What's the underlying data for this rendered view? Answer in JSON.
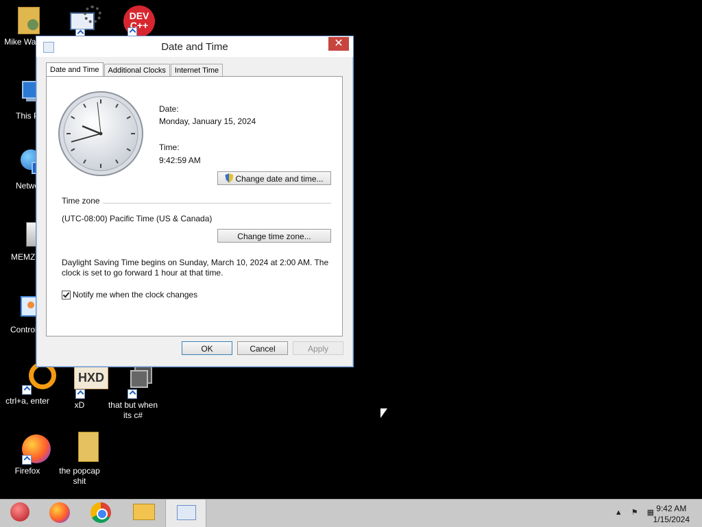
{
  "desktop": {
    "icons": [
      {
        "label": "Mike Wazow",
        "icon": "folder-user-icon"
      },
      {
        "label": "This P",
        "icon": "computer-icon"
      },
      {
        "label": "Netwo",
        "icon": "network-icon"
      },
      {
        "label": "MEMZ-D",
        "icon": "recycle-bin-icon"
      },
      {
        "label": "Control P",
        "icon": "control-panel-icon"
      },
      {
        "label": "ctrl+a, enter",
        "icon": "orange-ring-icon"
      },
      {
        "label": "xD",
        "icon": "hxd-icon"
      },
      {
        "label": "that but when its c#",
        "icon": "stacked-windows-icon"
      },
      {
        "label": "Firefox",
        "icon": "firefox-icon"
      },
      {
        "label": "the popcap shit",
        "icon": "folder-icon"
      },
      {
        "label": "",
        "icon": "settings-monitor-icon"
      },
      {
        "label": "DEV C++",
        "icon": "devcpp-icon"
      }
    ]
  },
  "window": {
    "title": "Date and Time",
    "tabs": [
      "Date and Time",
      "Additional Clocks",
      "Internet Time"
    ],
    "date_label": "Date:",
    "date_value": "Monday, January 15, 2024",
    "time_label": "Time:",
    "time_value": "9:42:59 AM",
    "change_datetime": "Change date and time...",
    "timezone_heading": "Time zone",
    "timezone_value": "(UTC-08:00) Pacific Time (US & Canada)",
    "change_timezone": "Change time zone...",
    "dst_line1": "Daylight Saving Time begins on Sunday, March 10, 2024 at 2:00 AM. The",
    "dst_line2": "clock is set to go forward 1 hour at that time.",
    "notify_label": "Notify me when the clock changes",
    "notify_checked": true,
    "ok": "OK",
    "cancel": "Cancel",
    "apply": "Apply",
    "close_glyph": "✕"
  },
  "taskbar": {
    "items": [
      "ornament-icon",
      "firefox-icon",
      "chrome-icon",
      "file-explorer-icon",
      "date-time-icon"
    ],
    "clock_time": "9:42 AM",
    "clock_date": "1/15/2024"
  }
}
